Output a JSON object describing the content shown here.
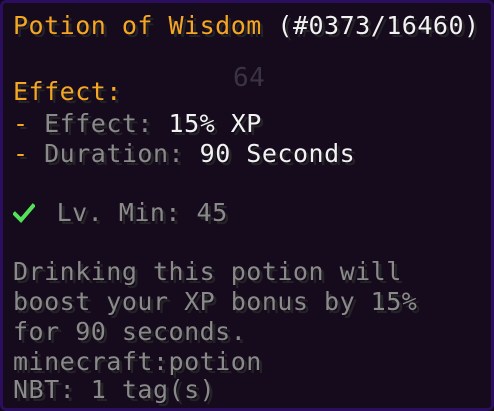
{
  "tooltip": {
    "title": {
      "name": "Potion of Wisdom",
      "id": "(#0373/16460)"
    },
    "background_slot_count": "64",
    "effect_header": "Effect:",
    "effects": [
      {
        "bullet": "-",
        "label": "Effect:",
        "value": "15% XP"
      },
      {
        "bullet": "-",
        "label": "Duration:",
        "value": "90 Seconds"
      }
    ],
    "requirement": {
      "icon": "check-icon",
      "label": "Lv. Min:",
      "value": "45",
      "met": true
    },
    "description": [
      "Drinking this potion will",
      "boost your XP bonus by 15%",
      "for 90 seconds."
    ],
    "item_id": "minecraft:potion",
    "nbt": "NBT: 1 tag(s)"
  },
  "colors": {
    "title": "#f5a623",
    "value": "#f2f2f2",
    "lore": "#8a8a8a",
    "check": "#55e05a",
    "background": "#150b1c",
    "border": "#2b0f5e"
  }
}
